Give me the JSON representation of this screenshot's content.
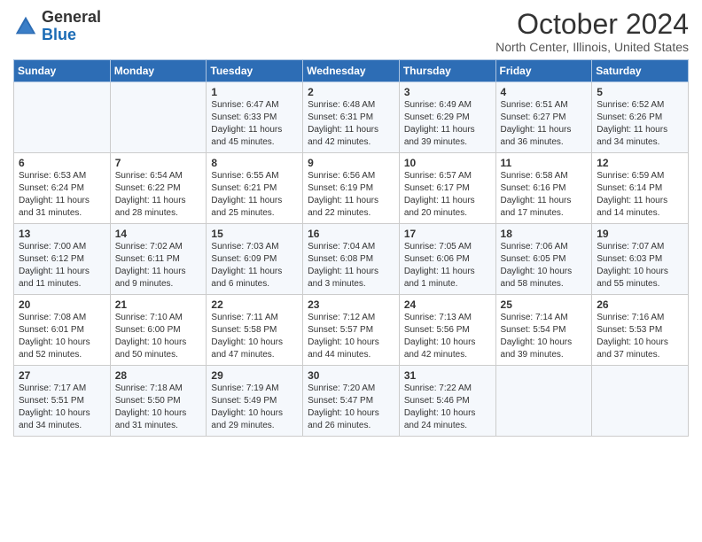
{
  "header": {
    "logo_general": "General",
    "logo_blue": "Blue",
    "month_title": "October 2024",
    "location": "North Center, Illinois, United States"
  },
  "days_of_week": [
    "Sunday",
    "Monday",
    "Tuesday",
    "Wednesday",
    "Thursday",
    "Friday",
    "Saturday"
  ],
  "weeks": [
    [
      {
        "day": "",
        "info": ""
      },
      {
        "day": "",
        "info": ""
      },
      {
        "day": "1",
        "info": "Sunrise: 6:47 AM\nSunset: 6:33 PM\nDaylight: 11 hours and 45 minutes."
      },
      {
        "day": "2",
        "info": "Sunrise: 6:48 AM\nSunset: 6:31 PM\nDaylight: 11 hours and 42 minutes."
      },
      {
        "day": "3",
        "info": "Sunrise: 6:49 AM\nSunset: 6:29 PM\nDaylight: 11 hours and 39 minutes."
      },
      {
        "day": "4",
        "info": "Sunrise: 6:51 AM\nSunset: 6:27 PM\nDaylight: 11 hours and 36 minutes."
      },
      {
        "day": "5",
        "info": "Sunrise: 6:52 AM\nSunset: 6:26 PM\nDaylight: 11 hours and 34 minutes."
      }
    ],
    [
      {
        "day": "6",
        "info": "Sunrise: 6:53 AM\nSunset: 6:24 PM\nDaylight: 11 hours and 31 minutes."
      },
      {
        "day": "7",
        "info": "Sunrise: 6:54 AM\nSunset: 6:22 PM\nDaylight: 11 hours and 28 minutes."
      },
      {
        "day": "8",
        "info": "Sunrise: 6:55 AM\nSunset: 6:21 PM\nDaylight: 11 hours and 25 minutes."
      },
      {
        "day": "9",
        "info": "Sunrise: 6:56 AM\nSunset: 6:19 PM\nDaylight: 11 hours and 22 minutes."
      },
      {
        "day": "10",
        "info": "Sunrise: 6:57 AM\nSunset: 6:17 PM\nDaylight: 11 hours and 20 minutes."
      },
      {
        "day": "11",
        "info": "Sunrise: 6:58 AM\nSunset: 6:16 PM\nDaylight: 11 hours and 17 minutes."
      },
      {
        "day": "12",
        "info": "Sunrise: 6:59 AM\nSunset: 6:14 PM\nDaylight: 11 hours and 14 minutes."
      }
    ],
    [
      {
        "day": "13",
        "info": "Sunrise: 7:00 AM\nSunset: 6:12 PM\nDaylight: 11 hours and 11 minutes."
      },
      {
        "day": "14",
        "info": "Sunrise: 7:02 AM\nSunset: 6:11 PM\nDaylight: 11 hours and 9 minutes."
      },
      {
        "day": "15",
        "info": "Sunrise: 7:03 AM\nSunset: 6:09 PM\nDaylight: 11 hours and 6 minutes."
      },
      {
        "day": "16",
        "info": "Sunrise: 7:04 AM\nSunset: 6:08 PM\nDaylight: 11 hours and 3 minutes."
      },
      {
        "day": "17",
        "info": "Sunrise: 7:05 AM\nSunset: 6:06 PM\nDaylight: 11 hours and 1 minute."
      },
      {
        "day": "18",
        "info": "Sunrise: 7:06 AM\nSunset: 6:05 PM\nDaylight: 10 hours and 58 minutes."
      },
      {
        "day": "19",
        "info": "Sunrise: 7:07 AM\nSunset: 6:03 PM\nDaylight: 10 hours and 55 minutes."
      }
    ],
    [
      {
        "day": "20",
        "info": "Sunrise: 7:08 AM\nSunset: 6:01 PM\nDaylight: 10 hours and 52 minutes."
      },
      {
        "day": "21",
        "info": "Sunrise: 7:10 AM\nSunset: 6:00 PM\nDaylight: 10 hours and 50 minutes."
      },
      {
        "day": "22",
        "info": "Sunrise: 7:11 AM\nSunset: 5:58 PM\nDaylight: 10 hours and 47 minutes."
      },
      {
        "day": "23",
        "info": "Sunrise: 7:12 AM\nSunset: 5:57 PM\nDaylight: 10 hours and 44 minutes."
      },
      {
        "day": "24",
        "info": "Sunrise: 7:13 AM\nSunset: 5:56 PM\nDaylight: 10 hours and 42 minutes."
      },
      {
        "day": "25",
        "info": "Sunrise: 7:14 AM\nSunset: 5:54 PM\nDaylight: 10 hours and 39 minutes."
      },
      {
        "day": "26",
        "info": "Sunrise: 7:16 AM\nSunset: 5:53 PM\nDaylight: 10 hours and 37 minutes."
      }
    ],
    [
      {
        "day": "27",
        "info": "Sunrise: 7:17 AM\nSunset: 5:51 PM\nDaylight: 10 hours and 34 minutes."
      },
      {
        "day": "28",
        "info": "Sunrise: 7:18 AM\nSunset: 5:50 PM\nDaylight: 10 hours and 31 minutes."
      },
      {
        "day": "29",
        "info": "Sunrise: 7:19 AM\nSunset: 5:49 PM\nDaylight: 10 hours and 29 minutes."
      },
      {
        "day": "30",
        "info": "Sunrise: 7:20 AM\nSunset: 5:47 PM\nDaylight: 10 hours and 26 minutes."
      },
      {
        "day": "31",
        "info": "Sunrise: 7:22 AM\nSunset: 5:46 PM\nDaylight: 10 hours and 24 minutes."
      },
      {
        "day": "",
        "info": ""
      },
      {
        "day": "",
        "info": ""
      }
    ]
  ]
}
